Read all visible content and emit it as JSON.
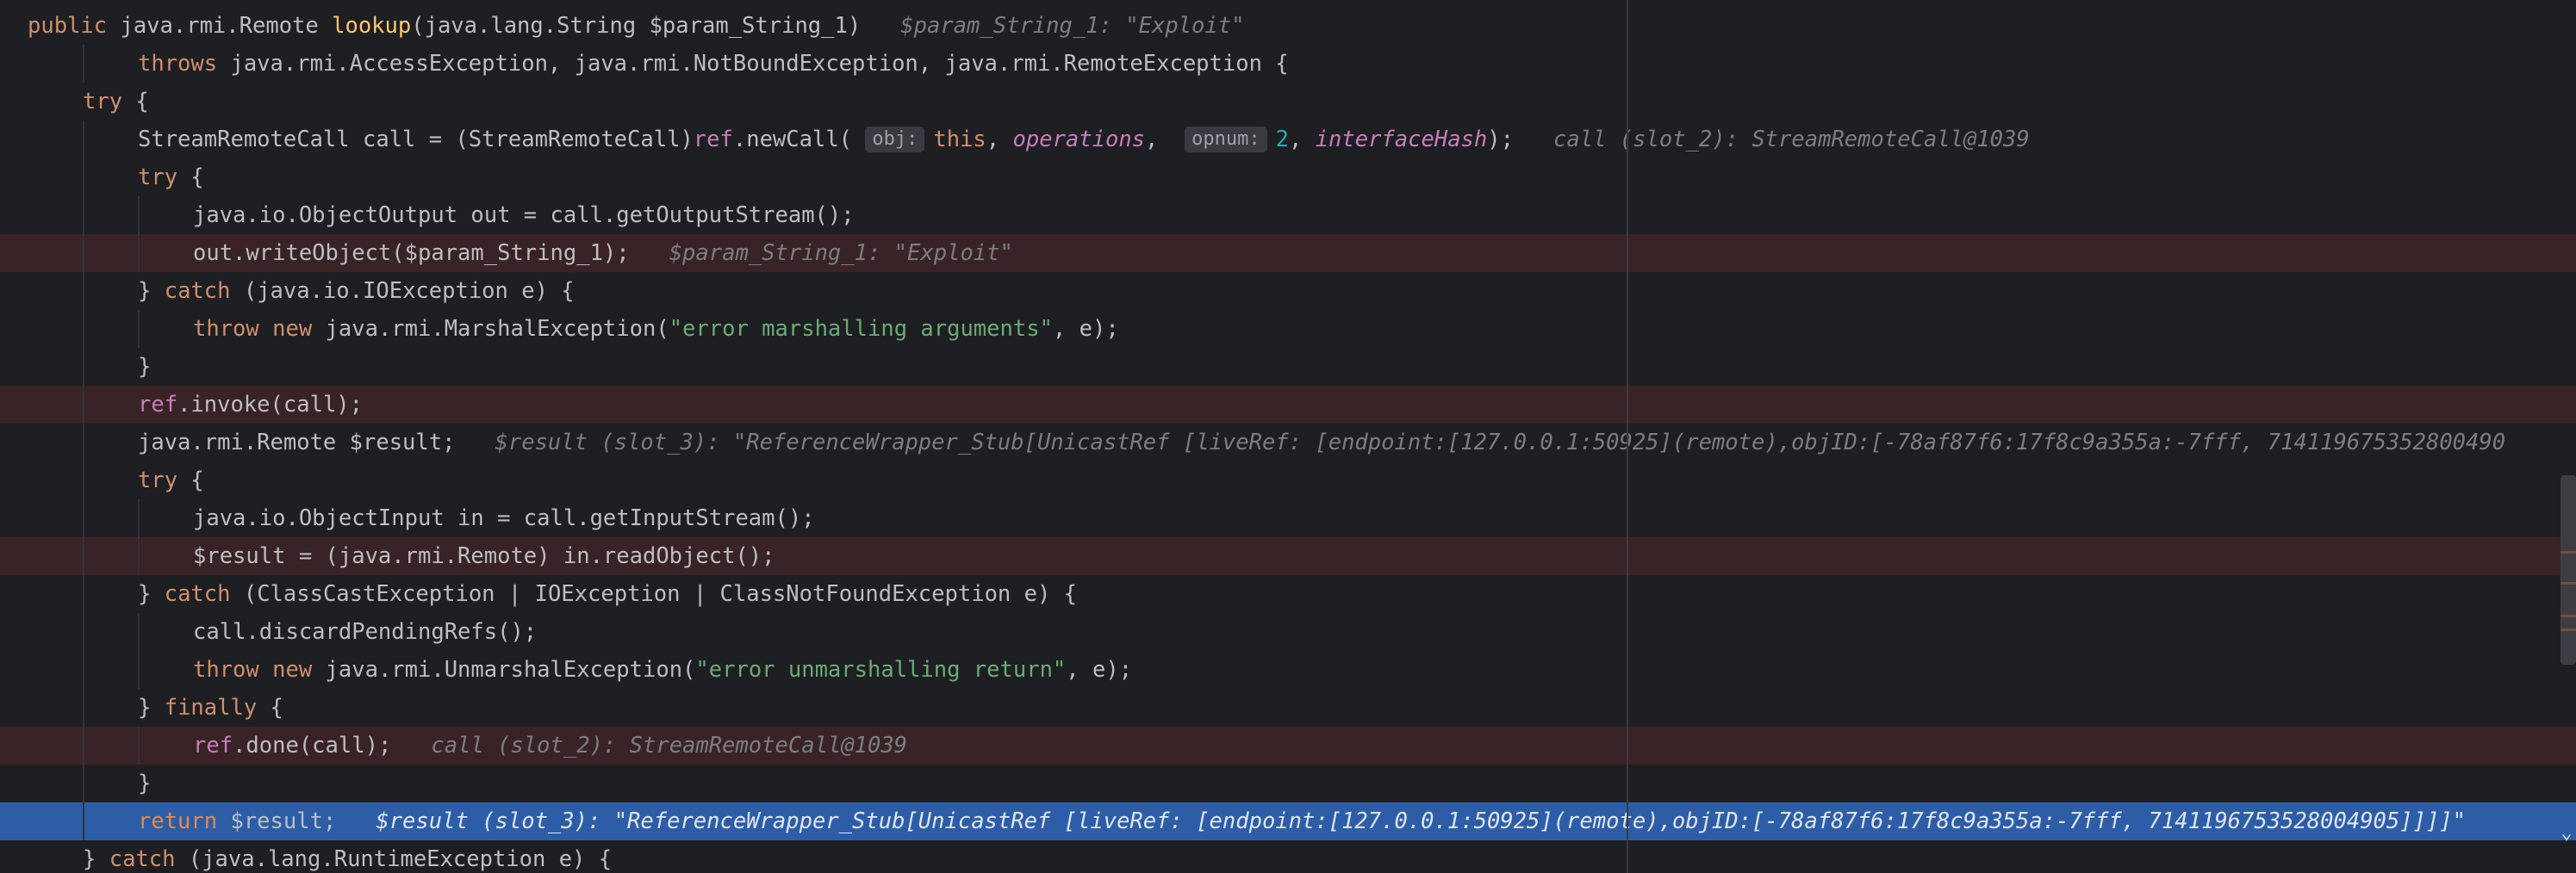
{
  "editor": {
    "lines": [
      {
        "parts": [
          {
            "t": "public ",
            "c": "kw"
          },
          {
            "t": "java.rmi.Remote "
          },
          {
            "t": "lookup",
            "c": "fn-decl"
          },
          {
            "t": "(java.lang.String $param_String_1)"
          },
          {
            "t": "   $param_String_1: \"Exploit\"",
            "c": "hint"
          }
        ]
      },
      {
        "parts": [
          {
            "t": "throws ",
            "c": "kw"
          },
          {
            "t": "java.rmi.AccessException, java.rmi.NotBoundException, java.rmi.RemoteException {"
          }
        ]
      },
      {
        "parts": [
          {
            "t": "try ",
            "c": "kw"
          },
          {
            "t": "{"
          }
        ]
      },
      {
        "parts": [
          {
            "t": "StreamRemoteCall call = (StreamRemoteCall)"
          },
          {
            "t": "ref",
            "c": "fieldp"
          },
          {
            "t": ".newCall( "
          },
          {
            "ph": "obj:"
          },
          {
            "t": "this",
            "c": "kw"
          },
          {
            "t": ", "
          },
          {
            "t": "operations",
            "c": "field"
          },
          {
            "t": ",  "
          },
          {
            "ph": "opnum:"
          },
          {
            "t": "2",
            "c": "num"
          },
          {
            "t": ", "
          },
          {
            "t": "interfaceHash",
            "c": "field"
          },
          {
            "t": ");"
          },
          {
            "t": "   call (slot_2): StreamRemoteCall@1039",
            "c": "hint"
          }
        ]
      },
      {
        "parts": [
          {
            "t": "try ",
            "c": "kw"
          },
          {
            "t": "{"
          }
        ]
      },
      {
        "parts": [
          {
            "t": "java.io.ObjectOutput out = call.getOutputStream();"
          }
        ]
      },
      {
        "parts": [
          {
            "t": "out.writeObject($param_String_1);"
          },
          {
            "t": "   $param_String_1: \"Exploit\"",
            "c": "hint"
          }
        ]
      },
      {
        "parts": [
          {
            "t": "} "
          },
          {
            "t": "catch ",
            "c": "kw"
          },
          {
            "t": "(java.io.IOException e) {"
          }
        ]
      },
      {
        "parts": [
          {
            "t": "throw new ",
            "c": "kw"
          },
          {
            "t": "java.rmi.MarshalException("
          },
          {
            "t": "\"error marshalling arguments\"",
            "c": "str"
          },
          {
            "t": ", e);"
          }
        ]
      },
      {
        "parts": [
          {
            "t": "}"
          }
        ]
      },
      {
        "parts": [
          {
            "t": "ref",
            "c": "fieldp"
          },
          {
            "t": ".invoke(call);"
          }
        ]
      },
      {
        "parts": [
          {
            "t": "java.rmi.Remote $result;"
          },
          {
            "t": "   $result (slot_3): \"ReferenceWrapper_Stub[UnicastRef [liveRef: [endpoint:[127.0.0.1:50925](remote),objID:[-78af87f6:17f8c9a355a:-7fff, 714119675352800490",
            "c": "hint"
          }
        ]
      },
      {
        "parts": [
          {
            "t": "try ",
            "c": "kw"
          },
          {
            "t": "{"
          }
        ]
      },
      {
        "parts": [
          {
            "t": "java.io.ObjectInput in = call.getInputStream();"
          }
        ]
      },
      {
        "parts": [
          {
            "t": "$result = (java.rmi.Remote) in.readObject();"
          }
        ]
      },
      {
        "parts": [
          {
            "t": "} "
          },
          {
            "t": "catch ",
            "c": "kw"
          },
          {
            "t": "(ClassCastException | IOException | ClassNotFoundException e) {"
          }
        ]
      },
      {
        "parts": [
          {
            "t": "call.discardPendingRefs();"
          }
        ]
      },
      {
        "parts": [
          {
            "t": "throw new ",
            "c": "kw"
          },
          {
            "t": "java.rmi.UnmarshalException("
          },
          {
            "t": "\"error unmarshalling return\"",
            "c": "str"
          },
          {
            "t": ", e);"
          }
        ]
      },
      {
        "parts": [
          {
            "t": "} "
          },
          {
            "t": "finally ",
            "c": "kw"
          },
          {
            "t": "{"
          }
        ]
      },
      {
        "parts": [
          {
            "t": "ref",
            "c": "fieldp"
          },
          {
            "t": ".done(call);"
          },
          {
            "t": "   call (slot_2): StreamRemoteCall@1039",
            "c": "hint"
          }
        ]
      },
      {
        "parts": [
          {
            "t": "}"
          }
        ]
      },
      {
        "parts": [
          {
            "t": "return ",
            "c": "kw"
          },
          {
            "t": "$result;"
          },
          {
            "t": "   $result (slot_3): \"ReferenceWrapper_Stub[UnicastRef [liveRef: [endpoint:[127.0.0.1:50925](remote),objID:[-78af87f6:17f8c9a355a:-7fff, 7141196753528004905]]]]\"",
            "c": "hint"
          }
        ]
      },
      {
        "parts": [
          {
            "t": "} "
          },
          {
            "t": "catch ",
            "c": "kw"
          },
          {
            "t": "(java.lang.RuntimeException e) {"
          }
        ]
      }
    ]
  },
  "icons": {
    "expand_hint": "chevron-down-icon"
  },
  "colors": {
    "background": "#1e1f22",
    "keyword": "#cf8e6d",
    "string": "#6aab73",
    "number": "#2aacb8",
    "field": "#c77dbb",
    "hint": "#7a7e85",
    "breakpoint_line": "#3a2326",
    "execution_line": "#2e5da8"
  }
}
